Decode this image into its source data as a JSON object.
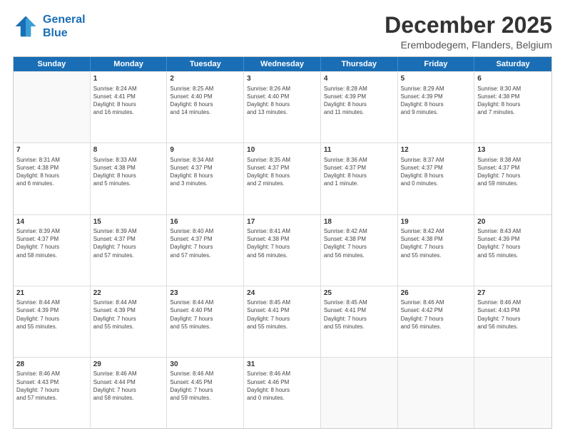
{
  "header": {
    "logo_line1": "General",
    "logo_line2": "Blue",
    "title": "December 2025",
    "subtitle": "Erembodegem, Flanders, Belgium"
  },
  "weekdays": [
    "Sunday",
    "Monday",
    "Tuesday",
    "Wednesday",
    "Thursday",
    "Friday",
    "Saturday"
  ],
  "weeks": [
    [
      {
        "day": "",
        "info": ""
      },
      {
        "day": "1",
        "info": "Sunrise: 8:24 AM\nSunset: 4:41 PM\nDaylight: 8 hours\nand 16 minutes."
      },
      {
        "day": "2",
        "info": "Sunrise: 8:25 AM\nSunset: 4:40 PM\nDaylight: 8 hours\nand 14 minutes."
      },
      {
        "day": "3",
        "info": "Sunrise: 8:26 AM\nSunset: 4:40 PM\nDaylight: 8 hours\nand 13 minutes."
      },
      {
        "day": "4",
        "info": "Sunrise: 8:28 AM\nSunset: 4:39 PM\nDaylight: 8 hours\nand 11 minutes."
      },
      {
        "day": "5",
        "info": "Sunrise: 8:29 AM\nSunset: 4:39 PM\nDaylight: 8 hours\nand 9 minutes."
      },
      {
        "day": "6",
        "info": "Sunrise: 8:30 AM\nSunset: 4:38 PM\nDaylight: 8 hours\nand 7 minutes."
      }
    ],
    [
      {
        "day": "7",
        "info": "Sunrise: 8:31 AM\nSunset: 4:38 PM\nDaylight: 8 hours\nand 6 minutes."
      },
      {
        "day": "8",
        "info": "Sunrise: 8:33 AM\nSunset: 4:38 PM\nDaylight: 8 hours\nand 5 minutes."
      },
      {
        "day": "9",
        "info": "Sunrise: 8:34 AM\nSunset: 4:37 PM\nDaylight: 8 hours\nand 3 minutes."
      },
      {
        "day": "10",
        "info": "Sunrise: 8:35 AM\nSunset: 4:37 PM\nDaylight: 8 hours\nand 2 minutes."
      },
      {
        "day": "11",
        "info": "Sunrise: 8:36 AM\nSunset: 4:37 PM\nDaylight: 8 hours\nand 1 minute."
      },
      {
        "day": "12",
        "info": "Sunrise: 8:37 AM\nSunset: 4:37 PM\nDaylight: 8 hours\nand 0 minutes."
      },
      {
        "day": "13",
        "info": "Sunrise: 8:38 AM\nSunset: 4:37 PM\nDaylight: 7 hours\nand 59 minutes."
      }
    ],
    [
      {
        "day": "14",
        "info": "Sunrise: 8:39 AM\nSunset: 4:37 PM\nDaylight: 7 hours\nand 58 minutes."
      },
      {
        "day": "15",
        "info": "Sunrise: 8:39 AM\nSunset: 4:37 PM\nDaylight: 7 hours\nand 57 minutes."
      },
      {
        "day": "16",
        "info": "Sunrise: 8:40 AM\nSunset: 4:37 PM\nDaylight: 7 hours\nand 57 minutes."
      },
      {
        "day": "17",
        "info": "Sunrise: 8:41 AM\nSunset: 4:38 PM\nDaylight: 7 hours\nand 56 minutes."
      },
      {
        "day": "18",
        "info": "Sunrise: 8:42 AM\nSunset: 4:38 PM\nDaylight: 7 hours\nand 56 minutes."
      },
      {
        "day": "19",
        "info": "Sunrise: 8:42 AM\nSunset: 4:38 PM\nDaylight: 7 hours\nand 55 minutes."
      },
      {
        "day": "20",
        "info": "Sunrise: 8:43 AM\nSunset: 4:39 PM\nDaylight: 7 hours\nand 55 minutes."
      }
    ],
    [
      {
        "day": "21",
        "info": "Sunrise: 8:44 AM\nSunset: 4:39 PM\nDaylight: 7 hours\nand 55 minutes."
      },
      {
        "day": "22",
        "info": "Sunrise: 8:44 AM\nSunset: 4:39 PM\nDaylight: 7 hours\nand 55 minutes."
      },
      {
        "day": "23",
        "info": "Sunrise: 8:44 AM\nSunset: 4:40 PM\nDaylight: 7 hours\nand 55 minutes."
      },
      {
        "day": "24",
        "info": "Sunrise: 8:45 AM\nSunset: 4:41 PM\nDaylight: 7 hours\nand 55 minutes."
      },
      {
        "day": "25",
        "info": "Sunrise: 8:45 AM\nSunset: 4:41 PM\nDaylight: 7 hours\nand 55 minutes."
      },
      {
        "day": "26",
        "info": "Sunrise: 8:46 AM\nSunset: 4:42 PM\nDaylight: 7 hours\nand 56 minutes."
      },
      {
        "day": "27",
        "info": "Sunrise: 8:46 AM\nSunset: 4:43 PM\nDaylight: 7 hours\nand 56 minutes."
      }
    ],
    [
      {
        "day": "28",
        "info": "Sunrise: 8:46 AM\nSunset: 4:43 PM\nDaylight: 7 hours\nand 57 minutes."
      },
      {
        "day": "29",
        "info": "Sunrise: 8:46 AM\nSunset: 4:44 PM\nDaylight: 7 hours\nand 58 minutes."
      },
      {
        "day": "30",
        "info": "Sunrise: 8:46 AM\nSunset: 4:45 PM\nDaylight: 7 hours\nand 59 minutes."
      },
      {
        "day": "31",
        "info": "Sunrise: 8:46 AM\nSunset: 4:46 PM\nDaylight: 8 hours\nand 0 minutes."
      },
      {
        "day": "",
        "info": ""
      },
      {
        "day": "",
        "info": ""
      },
      {
        "day": "",
        "info": ""
      }
    ]
  ]
}
